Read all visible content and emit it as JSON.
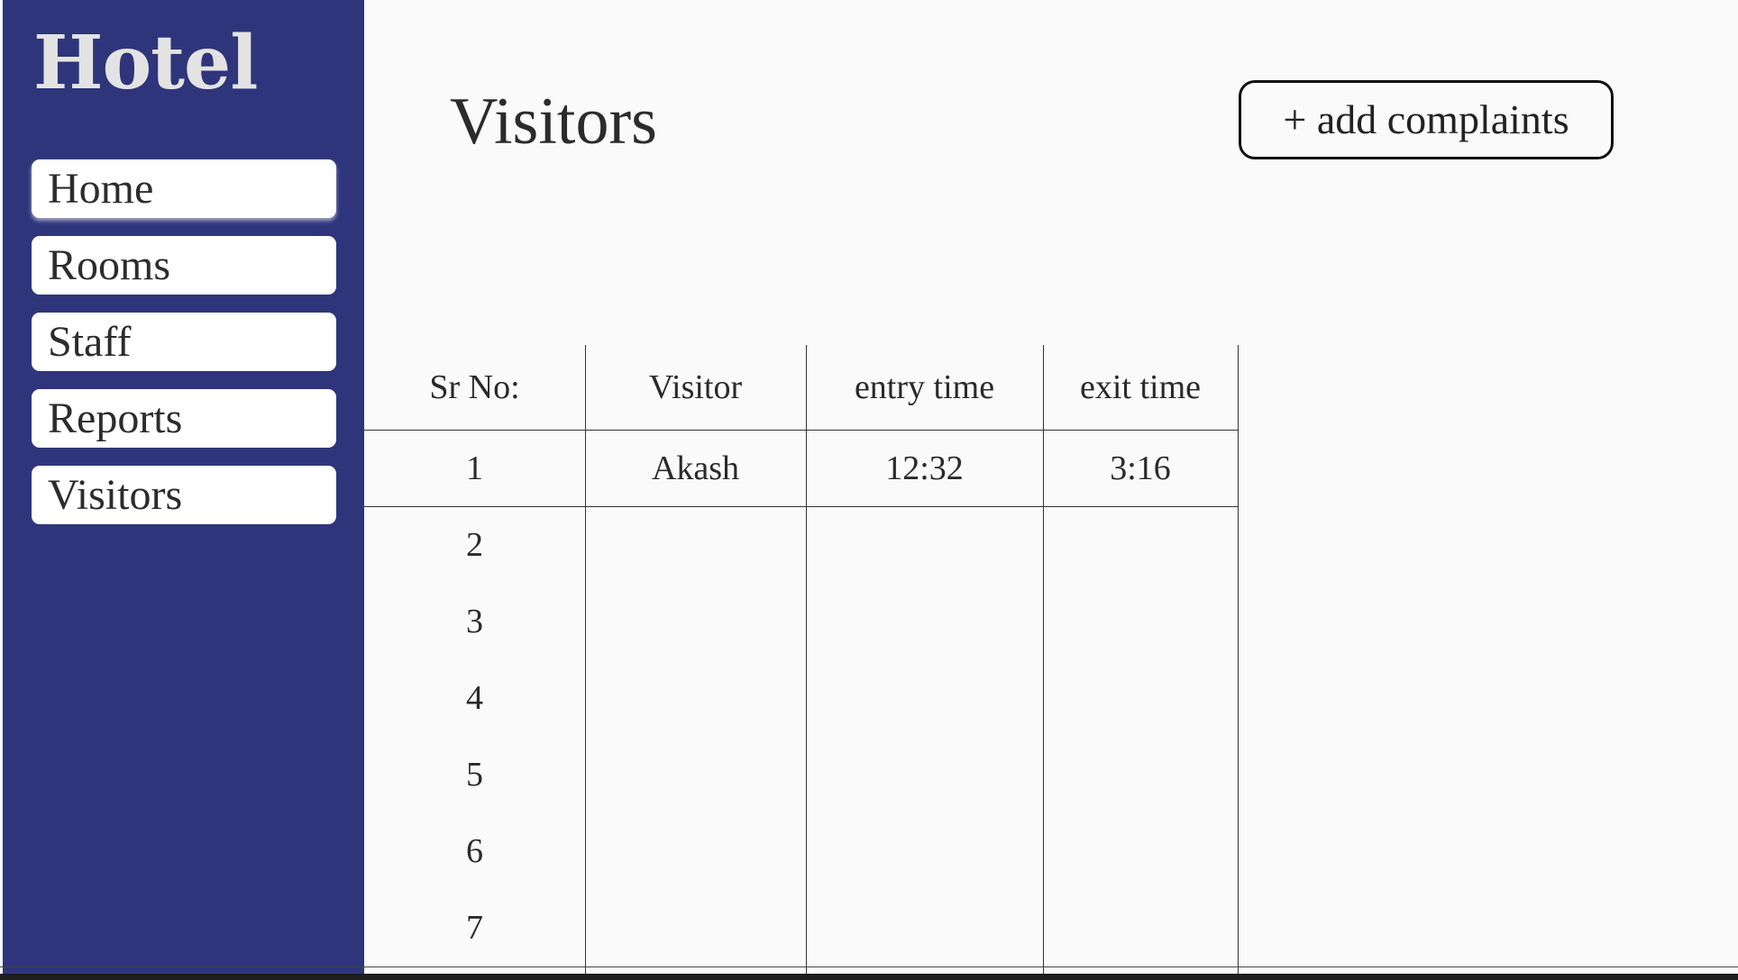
{
  "sidebar": {
    "brand": "Hotel",
    "items": [
      {
        "label": "Home"
      },
      {
        "label": "Rooms"
      },
      {
        "label": "Staff"
      },
      {
        "label": "Reports"
      },
      {
        "label": "Visitors"
      }
    ]
  },
  "header": {
    "title": "Visitors",
    "add_button_label": "+ add complaints"
  },
  "table": {
    "columns": [
      "Sr No:",
      "Visitor",
      "entry time",
      "exit time"
    ],
    "rows": [
      [
        "1",
        "Akash",
        "12:32",
        "3:16"
      ],
      [
        "2",
        "",
        "",
        ""
      ],
      [
        "3",
        "",
        "",
        ""
      ],
      [
        "4",
        "",
        "",
        ""
      ],
      [
        "5",
        "",
        "",
        ""
      ],
      [
        "6",
        "",
        "",
        ""
      ],
      [
        "7",
        "",
        "",
        ""
      ]
    ]
  },
  "colors": {
    "sidebar_bg": "#2e357a",
    "page_bg": "#fafafa",
    "brand_text": "#e3e3e3"
  }
}
